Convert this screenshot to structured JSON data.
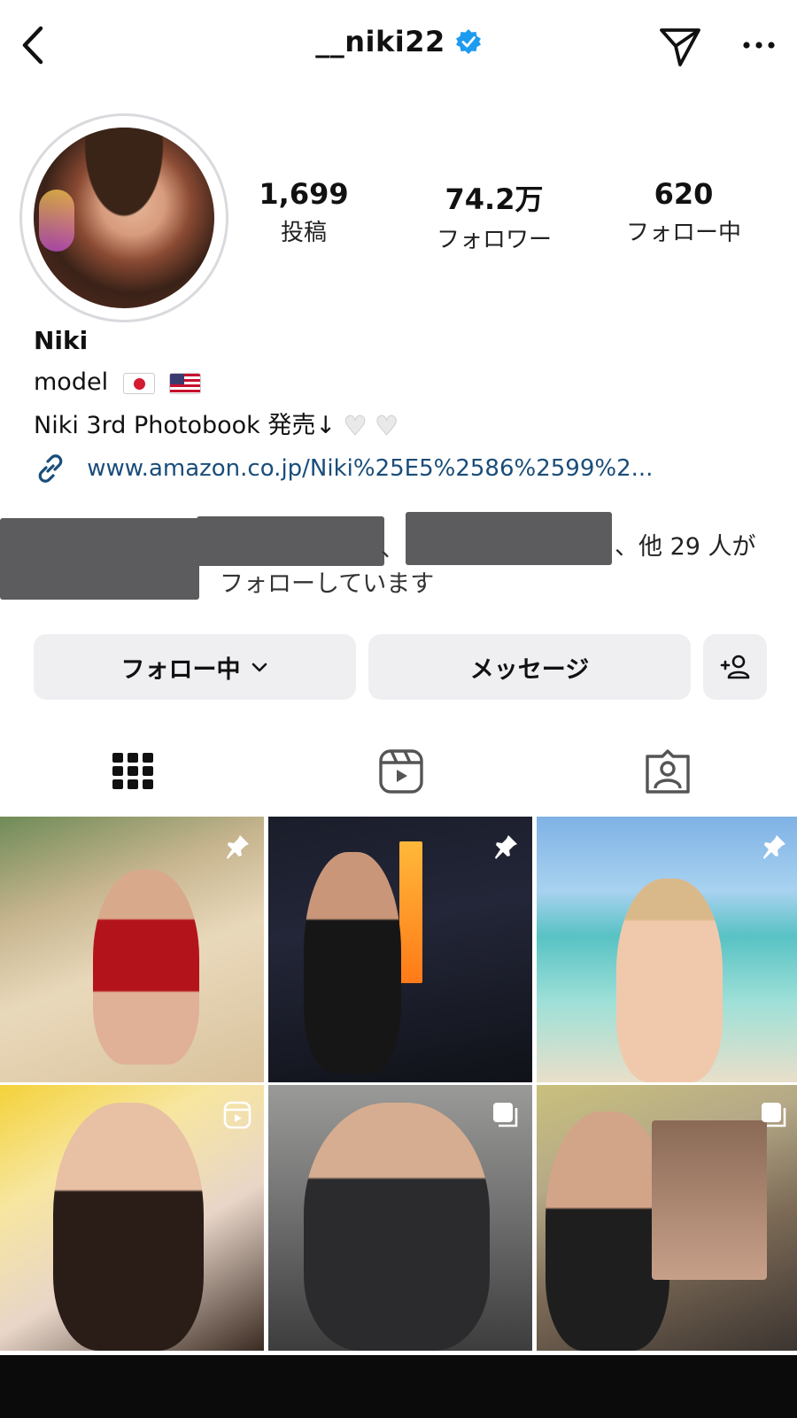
{
  "header": {
    "username": "__niki22",
    "verified": true
  },
  "profile": {
    "stats": {
      "posts_value": "1,699",
      "posts_label": "投稿",
      "followers_value": "74.2万",
      "followers_label": "フォロワー",
      "following_value": "620",
      "following_label": "フォロー中"
    },
    "name": "Niki",
    "bio_line1": "model",
    "bio_line2": "Niki 3rd Photobook 発売↓",
    "link": "www.amazon.co.jp/Niki%25E5%2586%2599%2..."
  },
  "followed_by": {
    "separator": "、",
    "tail_line1": "、他 29 人が",
    "tail_line2": "フォローしています"
  },
  "actions": {
    "following_label": "フォロー中",
    "message_label": "メッセージ"
  },
  "tabs": [
    "grid",
    "reels",
    "tagged"
  ],
  "posts": [
    {
      "icon": "pin-icon"
    },
    {
      "icon": "pin-icon"
    },
    {
      "icon": "pin-icon"
    },
    {
      "icon": "reel-icon"
    },
    {
      "icon": "carousel-icon"
    },
    {
      "icon": "carousel-icon"
    }
  ],
  "colors": {
    "link": "#1a4d7a",
    "verified": "#1d9bf0",
    "button_bg": "#efeff2"
  }
}
